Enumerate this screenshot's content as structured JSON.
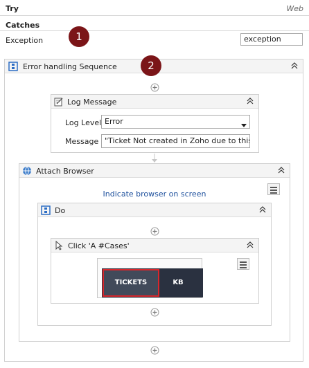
{
  "try_label": "Try",
  "web_label": "Web",
  "catches_label": "Catches",
  "exception_label": "Exception",
  "exception_value": "exception",
  "badge1": "1",
  "badge2": "2",
  "error_seq_title": "Error handling Sequence",
  "log_message": {
    "title": "Log Message",
    "level_label": "Log Level",
    "level_value": "Error",
    "message_label": "Message",
    "message_value": "\"Ticket Not created in Zoho due to this ex"
  },
  "attach_browser": {
    "title": "Attach Browser",
    "indicate_link": "Indicate browser on screen"
  },
  "do_seq": {
    "title": "Do"
  },
  "click_activity": {
    "title": "Click 'A  #Cases'",
    "tab_tickets": "TICKETS",
    "tab_kb": "KB"
  },
  "colors": {
    "badge": "#7b1518",
    "link": "#1c4f9c",
    "preview_bg": "#2a3140",
    "selection": "#d9262b"
  }
}
